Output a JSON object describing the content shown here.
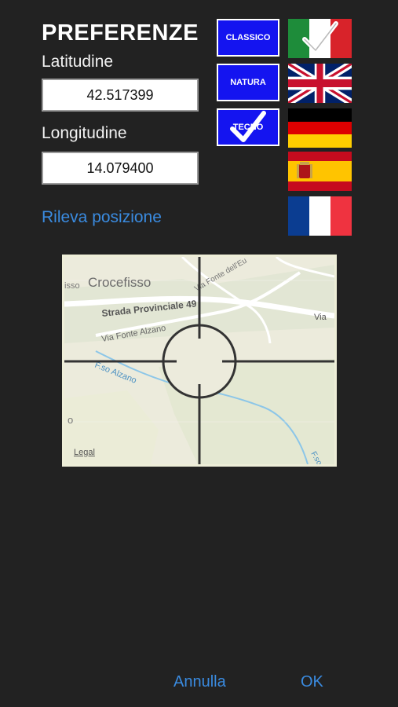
{
  "header": {
    "title": "PREFERENZE"
  },
  "latitude": {
    "label": "Latitudine",
    "value": "42.517399"
  },
  "longitude": {
    "label": "Longitudine",
    "value": "14.079400"
  },
  "detect_position_label": "Rileva posizione",
  "themes": [
    {
      "label": "CLASSICO",
      "selected": false
    },
    {
      "label": "NATURA",
      "selected": false
    },
    {
      "label": "TECNO",
      "selected": true
    }
  ],
  "languages": [
    {
      "name": "italian-flag",
      "selected": true
    },
    {
      "name": "uk-flag",
      "selected": false
    },
    {
      "name": "german-flag",
      "selected": false
    },
    {
      "name": "spanish-flag",
      "selected": false
    },
    {
      "name": "french-flag",
      "selected": false
    }
  ],
  "map": {
    "labels": [
      "Crocefisso",
      "Strada Provinciale 49",
      "Via Fonte Alzano",
      "Via Fonte dell'Eu",
      "F.so Alzano",
      "Via",
      "F.so",
      "isso",
      "o"
    ],
    "legal": "Legal"
  },
  "footer": {
    "cancel_label": "Annulla",
    "ok_label": "OK"
  },
  "colors": {
    "accent": "#3a8be0",
    "theme_button": "#1414f0",
    "background": "#222222"
  }
}
